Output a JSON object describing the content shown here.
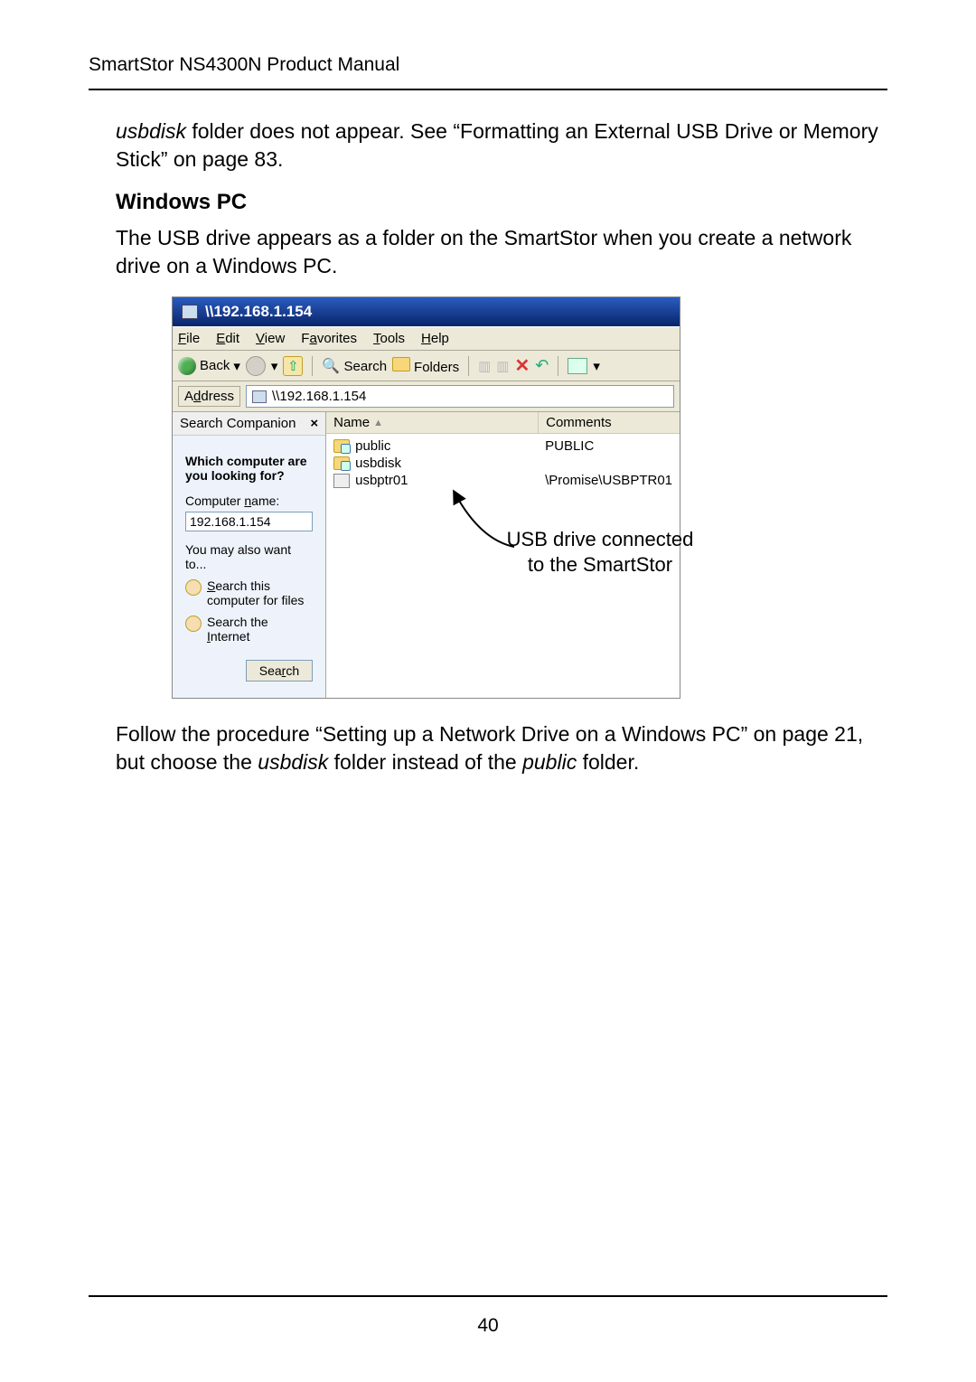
{
  "header": {
    "running": "SmartStor NS4300N Product Manual"
  },
  "para1_pre": "",
  "para1_italic": "usbdisk",
  "para1_post": " folder does not appear. See “Formatting an External USB Drive or Memory Stick” on page 83.",
  "h2": "Windows PC",
  "para2": "The USB drive appears as a folder on the SmartStor when you create a network drive on a Windows PC.",
  "window": {
    "title": "\\\\192.168.1.154",
    "menus": {
      "file": "File",
      "edit": "Edit",
      "view": "View",
      "favorites": "Favorites",
      "tools": "Tools",
      "help": "Help"
    },
    "toolbar": {
      "back": "Back",
      "search": "Search",
      "folders": "Folders"
    },
    "address": {
      "label": "Address",
      "value": "\\\\192.168.1.154"
    },
    "side": {
      "title": "Search Companion",
      "question": "Which computer are you looking for?",
      "cn_label": "Computer name:",
      "cn_value": "192.168.1.154",
      "also": "You may also want to...",
      "link1": "Search this computer for files",
      "link2": "Search the Internet",
      "search_btn": "Search"
    },
    "cols": {
      "name": "Name",
      "comments": "Comments"
    },
    "rows": [
      {
        "name": "public",
        "comment": "PUBLIC",
        "icon": "share"
      },
      {
        "name": "usbdisk",
        "comment": "",
        "icon": "share"
      },
      {
        "name": "usbptr01",
        "comment": "\\Promise\\USBPTR01",
        "icon": "printer"
      }
    ],
    "callout1": "USB drive connected",
    "callout2": "to the SmartStor"
  },
  "para3_a": "Follow the procedure “Setting up a Network Drive on a Windows PC” on page 21, but choose the ",
  "para3_i1": "usbdisk",
  "para3_b": " folder instead of the ",
  "para3_i2": "public",
  "para3_c": " folder.",
  "page_number": "40"
}
